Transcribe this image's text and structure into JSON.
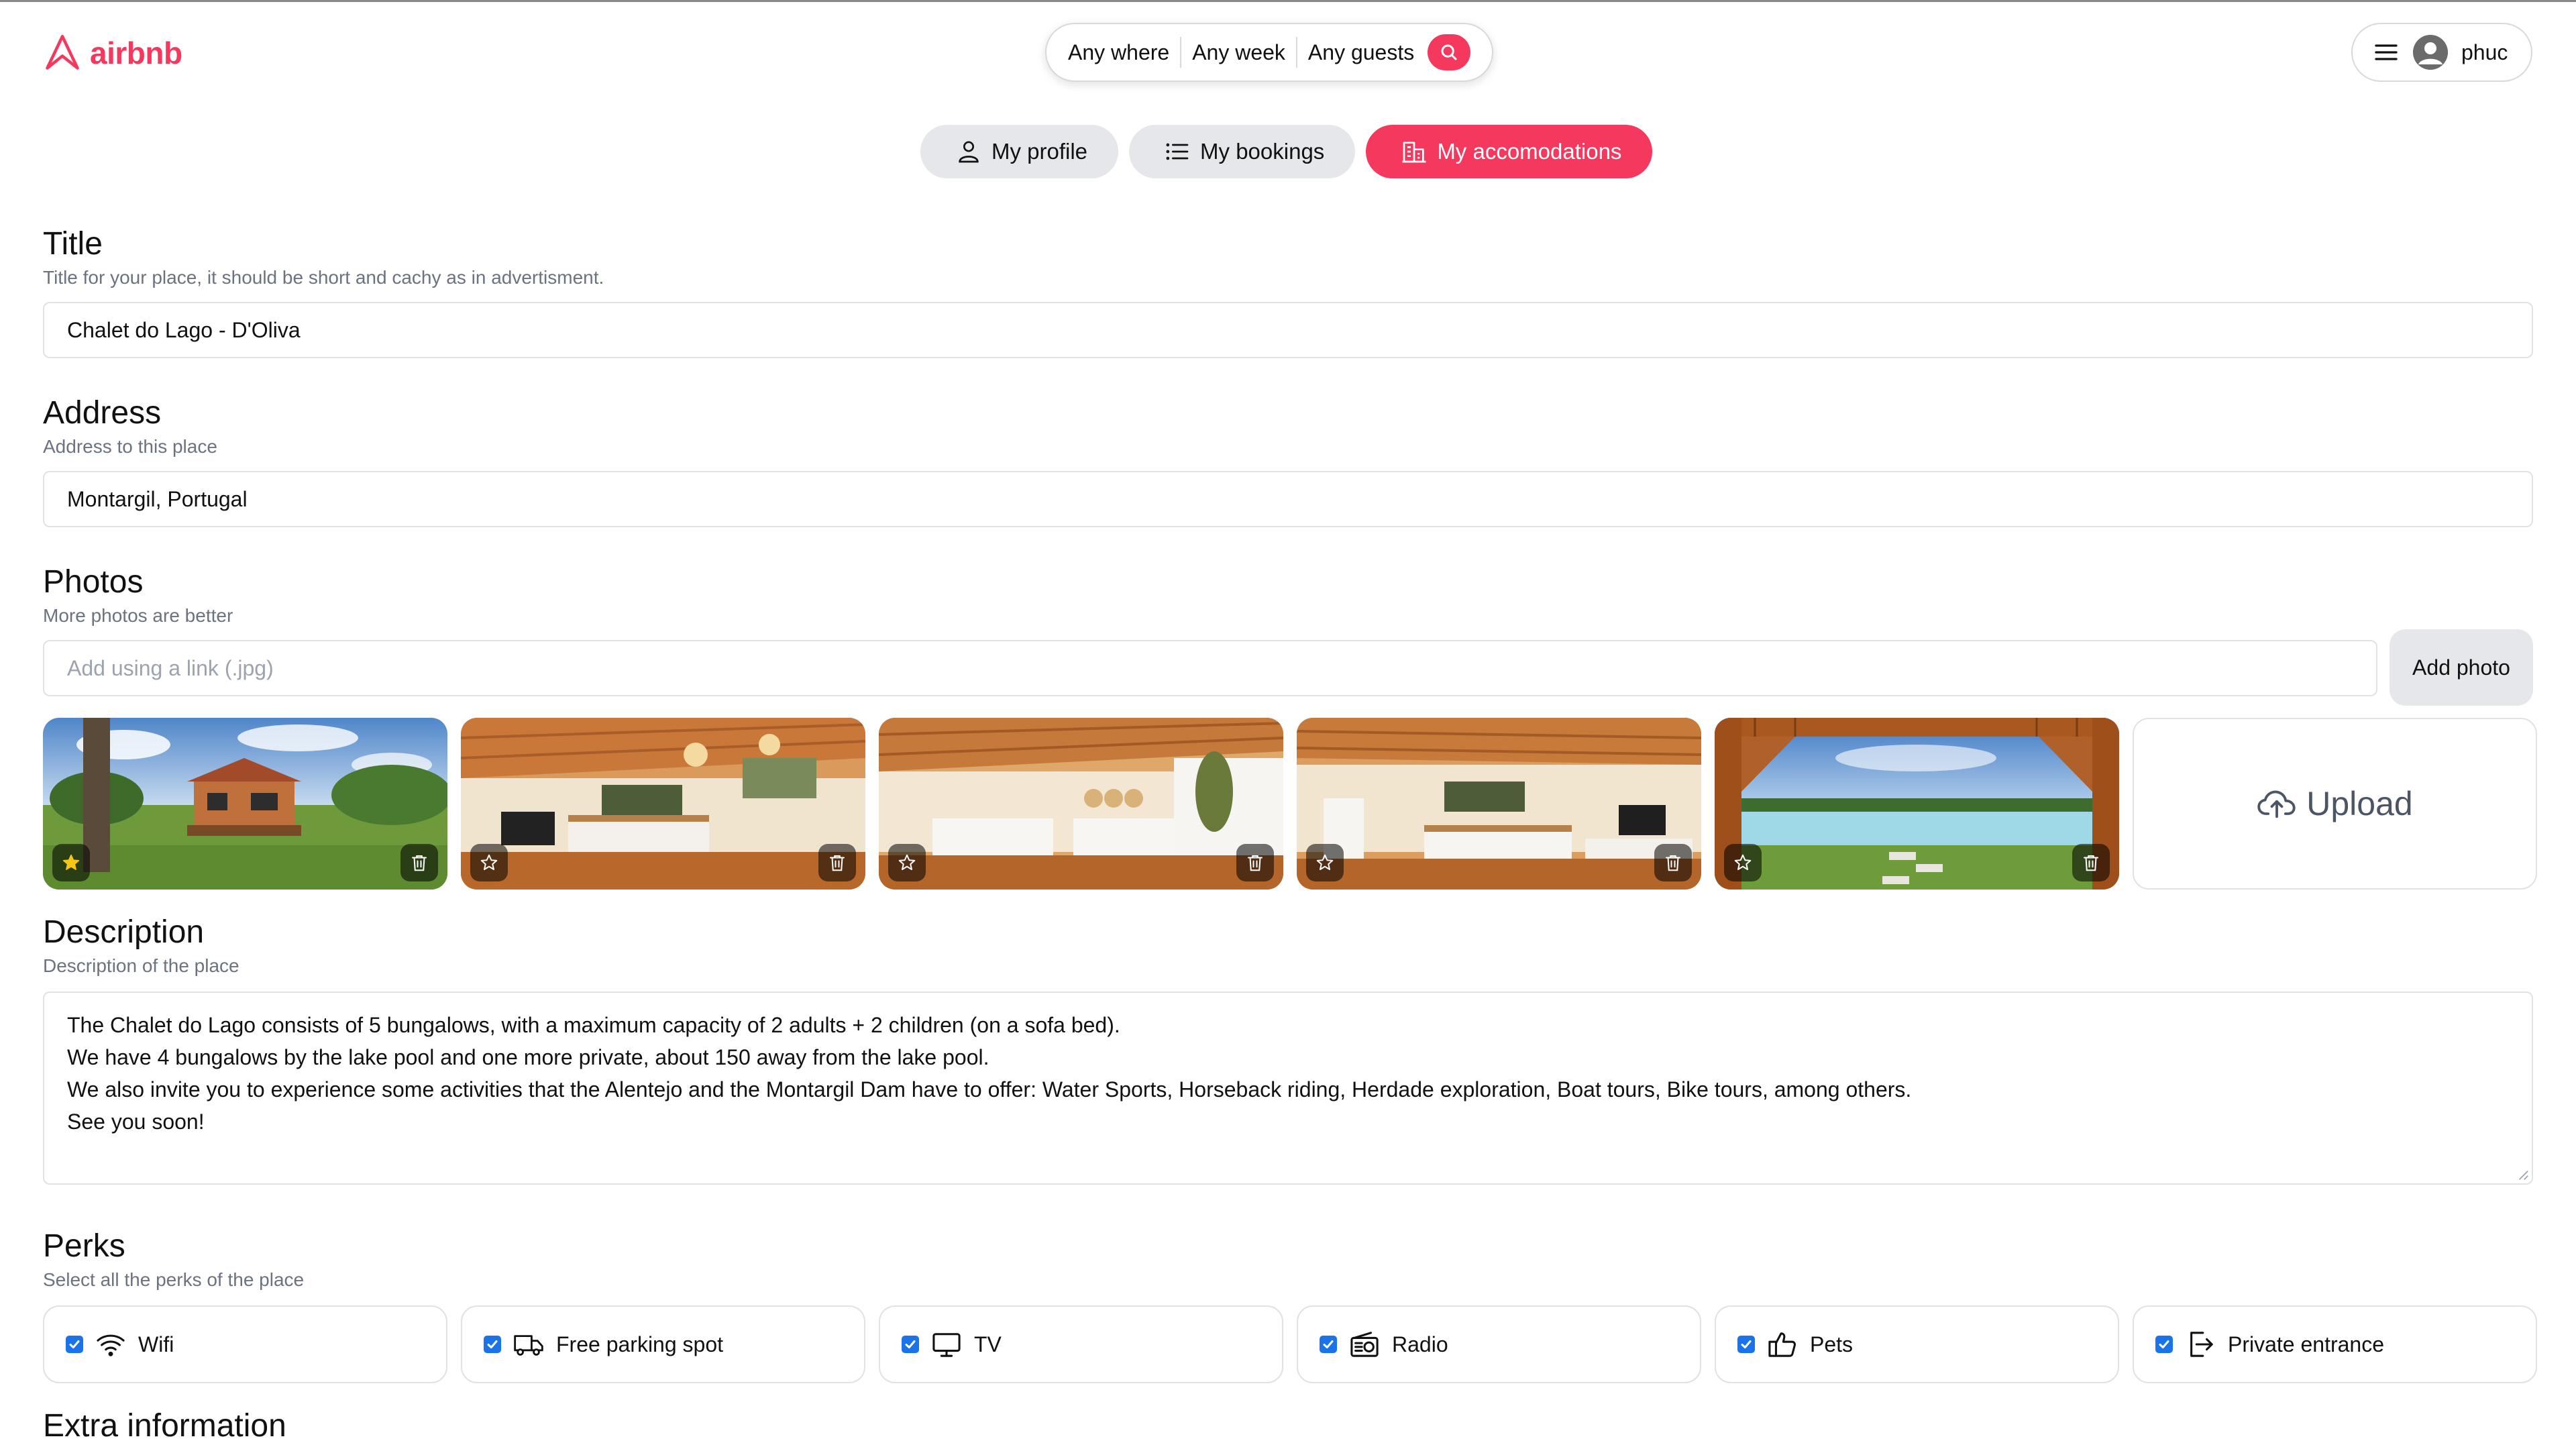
{
  "header": {
    "brand": "airbnb",
    "search": {
      "where": "Any where",
      "when": "Any week",
      "who": "Any guests"
    },
    "user": {
      "name": "phuc"
    }
  },
  "nav": {
    "profile": "My profile",
    "bookings": "My bookings",
    "accommodations": "My accomodations",
    "active": "accommodations"
  },
  "form": {
    "title": {
      "heading": "Title",
      "help": "Title for your place, it should be short and cachy as in advertisment.",
      "value": "Chalet do Lago - D'Oliva"
    },
    "address": {
      "heading": "Address",
      "help": "Address to this place",
      "value": "Montargil, Portugal"
    },
    "photos": {
      "heading": "Photos",
      "help": "More photos are better",
      "link_placeholder": "Add using a link (.jpg)",
      "add_button": "Add photo",
      "upload_label": "Upload",
      "items": [
        {
          "subject": "cabin exterior with tree",
          "main": true
        },
        {
          "subject": "kitchen interior",
          "main": false
        },
        {
          "subject": "bedroom interior",
          "main": false
        },
        {
          "subject": "kitchen and living area",
          "main": false
        },
        {
          "subject": "pergola with lake pool",
          "main": false
        }
      ]
    },
    "description": {
      "heading": "Description",
      "help": "Description of the place",
      "lines": [
        "The Chalet do Lago consists of 5 bungalows, with a maximum capacity of 2 adults + 2 children (on a sofa bed).",
        "We have 4 bungalows by the lake pool and one more private, about 150 away from the lake pool.",
        "We also invite you to experience some activities that the Alentejo and the Montargil Dam have to offer: Water Sports, Horseback riding, Herdade exploration, Boat tours, Bike tours, among others.",
        "See you soon!"
      ]
    },
    "perks": {
      "heading": "Perks",
      "help": "Select all the perks of the place",
      "items": [
        {
          "label": "Wifi",
          "icon": "wifi-icon",
          "checked": true
        },
        {
          "label": "Free parking spot",
          "icon": "truck-icon",
          "checked": true
        },
        {
          "label": "TV",
          "icon": "tv-icon",
          "checked": true
        },
        {
          "label": "Radio",
          "icon": "radio-icon",
          "checked": true
        },
        {
          "label": "Pets",
          "icon": "thumbs-up-icon",
          "checked": true
        },
        {
          "label": "Private entrance",
          "icon": "entrance-icon",
          "checked": true
        }
      ]
    },
    "extra": {
      "heading": "Extra information"
    }
  },
  "colors": {
    "brand": "#f5385d",
    "pill": "#e5e7eb",
    "checkbox": "#1a73e8",
    "muted": "#6b7280"
  }
}
